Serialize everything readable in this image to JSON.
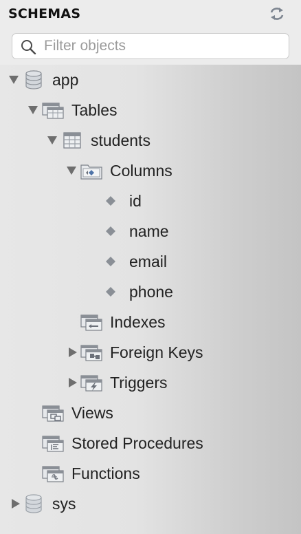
{
  "panel": {
    "title": "SCHEMAS",
    "refresh_icon": "refresh-icon",
    "search": {
      "placeholder": "Filter objects",
      "value": ""
    }
  },
  "tree": {
    "app": {
      "label": "app",
      "expanded": true,
      "tables": {
        "label": "Tables",
        "expanded": true,
        "students": {
          "label": "students",
          "expanded": true,
          "columns": {
            "label": "Columns",
            "expanded": true,
            "items": [
              "id",
              "name",
              "email",
              "phone"
            ]
          },
          "indexes": {
            "label": "Indexes"
          },
          "foreign_keys": {
            "label": "Foreign Keys",
            "expanded": false
          },
          "triggers": {
            "label": "Triggers",
            "expanded": false
          }
        }
      },
      "views": {
        "label": "Views"
      },
      "stored_procedures": {
        "label": "Stored Procedures"
      },
      "functions": {
        "label": "Functions"
      }
    },
    "sys": {
      "label": "sys",
      "expanded": false
    }
  },
  "colors": {
    "header_bg": "#ececec",
    "tree_gradient_start": "#e7e7e7",
    "tree_gradient_end": "#c4c4c4",
    "disclosure": "#6e6e6e",
    "icon_gray": "#8a8f96",
    "icon_blue": "#4f74a8"
  }
}
